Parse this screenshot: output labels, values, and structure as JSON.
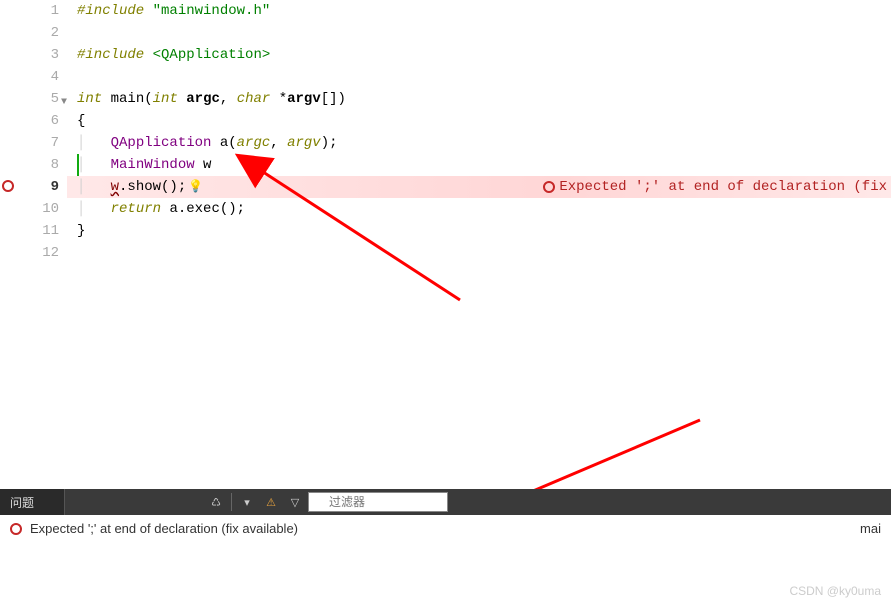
{
  "gutter": {
    "lines": [
      "1",
      "2",
      "3",
      "4",
      "5",
      "6",
      "7",
      "8",
      "9",
      "10",
      "11",
      "12"
    ],
    "currentIndex": 8,
    "errorIndex": 8,
    "foldIndex": 4
  },
  "code": {
    "l1": {
      "include": "#include",
      "file": "\"mainwindow.h\""
    },
    "l3": {
      "include": "#include",
      "file": "<QApplication>"
    },
    "l5": {
      "ret": "int",
      "name": "main",
      "p1": "int",
      "a1": "argc",
      "p2": "char",
      "star": "*",
      "a2": "argv",
      "br": "[]",
      "open": "(",
      "close": ")"
    },
    "l6": {
      "brace": "{"
    },
    "l7": {
      "type": "QApplication",
      "var": "a",
      "open": "(",
      "a1": "argc",
      "comma": ",",
      "a2": "argv",
      "close": ")",
      "semi": ";"
    },
    "l8": {
      "type": "MainWindow",
      "var": "w"
    },
    "l9": {
      "obj": "w",
      "dot": ".",
      "method": "show",
      "call": "();"
    },
    "l10": {
      "kw": "return",
      "obj": "a",
      "dot": ".",
      "method": "exec",
      "call": "();"
    },
    "l11": {
      "brace": "}"
    }
  },
  "error": {
    "inline": "Expected ';' at end of declaration (fix",
    "panel": "Expected ';' at end of declaration (fix available)",
    "file": "mai"
  },
  "panel": {
    "tab": "问题",
    "filterPlaceholder": "过滤器"
  },
  "watermark": "CSDN @ky0uma"
}
